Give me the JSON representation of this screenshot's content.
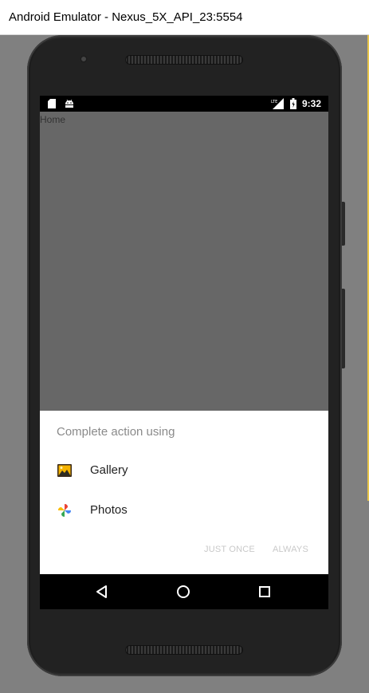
{
  "window": {
    "title": "Android Emulator - Nexus_5X_API_23:5554"
  },
  "status_bar": {
    "left_icons": [
      "sd-card-icon",
      "android-debug-icon"
    ],
    "right_icons": [
      "lte-signal-icon",
      "battery-charging-icon"
    ],
    "time": "9:32"
  },
  "app": {
    "title": "Home"
  },
  "chooser": {
    "title": "Complete action using",
    "options": [
      {
        "label": "Gallery",
        "icon": "gallery-icon"
      },
      {
        "label": "Photos",
        "icon": "photos-pinwheel-icon"
      }
    ],
    "buttons": {
      "just_once": "JUST ONCE",
      "always": "ALWAYS"
    }
  },
  "nav_bar": {
    "icons": [
      "back-icon",
      "home-icon",
      "recents-icon"
    ]
  },
  "colors": {
    "app_background": "#676767",
    "sheet_background": "#ffffff",
    "disabled_button": "#c9c9c9"
  }
}
